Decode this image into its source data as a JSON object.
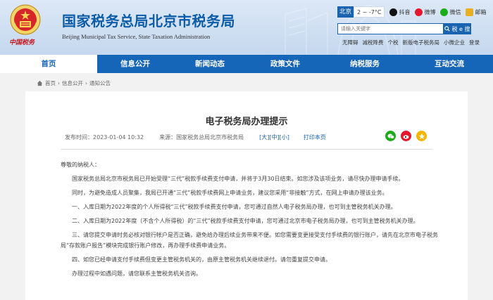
{
  "header": {
    "logo_script": "中国税务",
    "title_cn": "国家税务总局北京市税务局",
    "title_en": "Beijing Municipal Tax Service, State Taxation Administration",
    "city": "北京",
    "weather": "2 ~ -7°C",
    "social": [
      {
        "label": "抖音",
        "icon": "douyin-icon",
        "color": "#111111"
      },
      {
        "label": "微博",
        "icon": "weibo-icon",
        "color": "#e6162d"
      },
      {
        "label": "微信",
        "icon": "wechat-icon",
        "color": "#1aad19"
      },
      {
        "label": "邮箱",
        "icon": "mail-icon",
        "color": "#e8b020"
      }
    ],
    "search_placeholder": "请输入关键字",
    "search_button": "税 e 搜",
    "quick_links": [
      "无障碍",
      "减税降费",
      "个税",
      "新版电子税务局",
      "小微企业",
      "登录"
    ]
  },
  "nav": [
    {
      "label": "首页",
      "active": true
    },
    {
      "label": "信息公开",
      "active": false
    },
    {
      "label": "新闻动态",
      "active": false
    },
    {
      "label": "政策文件",
      "active": false
    },
    {
      "label": "纳税服务",
      "active": false
    },
    {
      "label": "互动交流",
      "active": false
    }
  ],
  "breadcrumb": [
    "首页",
    "信息公开",
    "通知公告"
  ],
  "article": {
    "title": "电子税务局办理提示",
    "publish_label": "发布时间：",
    "publish_time": "2023-01-04 10:32",
    "source_label": "来源：",
    "source": "国家税务总局北京市税务局",
    "font_large": "[大]",
    "font_medium": "[中]",
    "font_small": "[小]",
    "print": "打印本页",
    "paragraphs": [
      "尊敬的纳税人：",
      "国家税务总局北京市税务局已开始受理“三代”税款手续费支付申请，并将于3月30日结束。如您涉及该项业务，请尽快办理申请手续。",
      "同时，为避免造成人员聚集，我局已开通“三代”税款手续费网上申请业务，建议您采用“非接触”方式，在网上申请办理该业务。",
      "一、入库日期为2022年度的个人所得税“三代”税款手续费支付申请，您可通过自然人电子税务局办理，也可到主管税务机关办理。",
      "二、入库日期为2022年度（不含个人所得税）的“三代”税款手续费支付申请，您可通过北京市电子税务局办理，也可到主管税务机关办理。",
      "三、请您提交申请时务必核对银行帐户是否正确，避免给办理后续业务带来不便。如您需要变更接受支付手续费的银行账户，请先在北京市电子税务局“存款账户报告”模块完成银行账户修改，再办理手续费申请业务。",
      "四、如您已经申请支付手续费但变更主管税务机关的，由原主管税务机关继续退付。请勿重复提交申请。",
      "办理过程中如遇问题，请您联系主管税务机关咨询。"
    ]
  }
}
